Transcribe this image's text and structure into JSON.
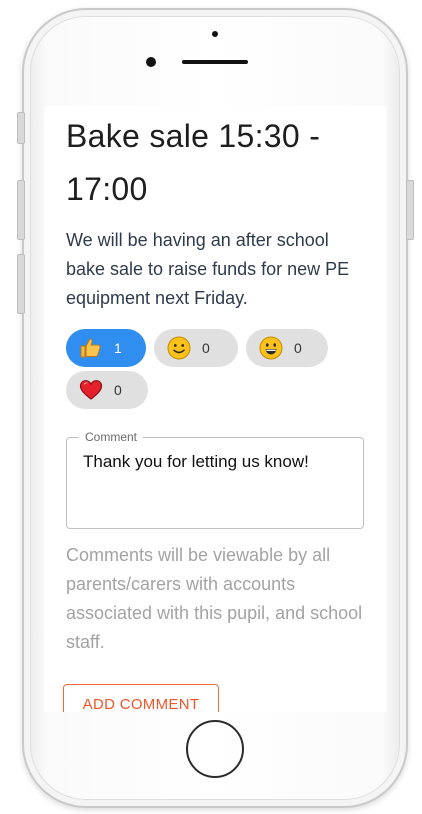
{
  "post": {
    "title": "Bake sale 15:30 - 17:00",
    "description": "We will be having an after school bake sale to raise funds for new PE equipment next Friday."
  },
  "reactions": [
    {
      "icon": "thumbs-up-icon",
      "count": "1",
      "active": true
    },
    {
      "icon": "smile-icon",
      "count": "0",
      "active": false
    },
    {
      "icon": "grin-icon",
      "count": "0",
      "active": false
    },
    {
      "icon": "heart-icon",
      "count": "0",
      "active": false
    }
  ],
  "comment": {
    "label": "Comment",
    "value": "Thank you for letting us know!"
  },
  "note": "Comments will be viewable by all parents/carers with accounts associated with this pupil, and school staff.",
  "add_comment_label": "ADD COMMENT",
  "colors": {
    "active_reaction": "#2f8ef0",
    "reaction_bg": "#e0e0e0",
    "accent": "#f0552b"
  }
}
